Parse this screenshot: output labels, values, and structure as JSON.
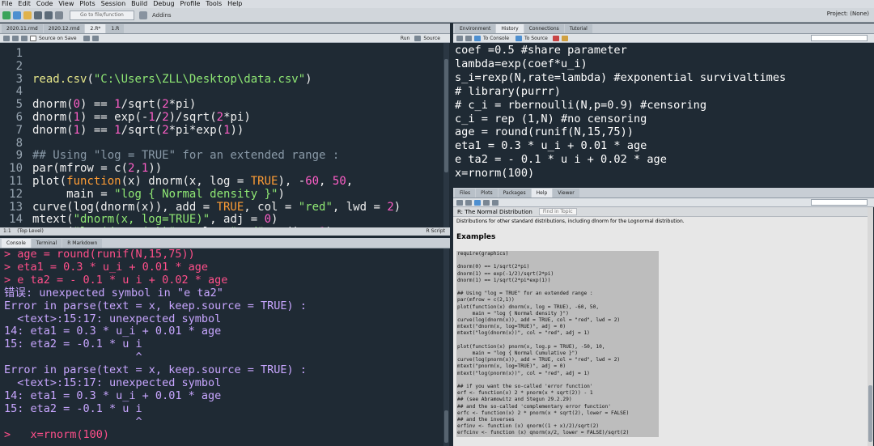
{
  "menu": [
    "File",
    "Edit",
    "Code",
    "View",
    "Plots",
    "Session",
    "Build",
    "Debug",
    "Profile",
    "Tools",
    "Help"
  ],
  "toolbar": {
    "goto_placeholder": "Go to file/function",
    "addins": "Addins",
    "project": "Project: (None)"
  },
  "editor": {
    "tabs": [
      "2020.11.rmd",
      "2020.12.rmd",
      "2.R*",
      "1.R"
    ],
    "active_tab": "2.R*",
    "source_on_save": "Source on Save",
    "run_label": "Run",
    "source_label": "Source",
    "line_numbers": [
      "1",
      "2",
      "3",
      "4",
      "5",
      "6",
      "7",
      "8",
      "9",
      "10",
      "11",
      "12",
      "13",
      "14"
    ],
    "status_pos": "1:1",
    "status_scope": "(Top Level)",
    "status_type": "R Script"
  },
  "console": {
    "tabs": [
      "Console",
      "Terminal",
      "R Markdown"
    ],
    "lines": [
      {
        "cls": "c-in",
        "text": "> age = round(runif(N,15,75))"
      },
      {
        "cls": "c-in",
        "text": "> eta1 = 0.3 * u_i + 0.01 * age"
      },
      {
        "cls": "c-in",
        "text": "> e ta2 = - 0.1 * u i + 0.02 * age"
      },
      {
        "cls": "c-err",
        "text": "错误: unexpected symbol in \"e ta2\""
      },
      {
        "cls": "c-err",
        "text": "Error in parse(text = x, keep.source = TRUE) :"
      },
      {
        "cls": "c-err",
        "text": "  <text>:15:17: unexpected symbol"
      },
      {
        "cls": "c-err",
        "text": "14: eta1 = 0.3 * u_i + 0.01 * age"
      },
      {
        "cls": "c-err",
        "text": "15: eta2 = -0.1 * u i"
      },
      {
        "cls": "c-err",
        "text": "                    ^"
      },
      {
        "cls": "c-err",
        "text": "Error in parse(text = x, keep.source = TRUE) :"
      },
      {
        "cls": "c-err",
        "text": "  <text>:15:17: unexpected symbol"
      },
      {
        "cls": "c-err",
        "text": "14: eta1 = 0.3 * u_i + 0.01 * age"
      },
      {
        "cls": "c-err",
        "text": "15: eta2 = -0.1 * u i"
      },
      {
        "cls": "c-err",
        "text": "                    ^"
      },
      {
        "cls": "c-in",
        "text": ">   x=rnorm(100)"
      }
    ]
  },
  "environment": {
    "tabs": [
      "Environment",
      "History",
      "Connections",
      "Tutorial"
    ],
    "to_console": "To Console",
    "to_source": "To Source",
    "lines": [
      "coef =0.5 #share parameter",
      "lambda=exp(coef*u_i)",
      "s_i=rexp(N,rate=lambda) #exponential survivaltimes",
      "# library(purrr)",
      "# c_i = rbernoulli(N,p=0.9) #censoring",
      "c_i = rep (1,N) #no censoring",
      "age = round(runif(N,15,75))",
      "eta1 = 0.3 * u_i + 0.01 * age",
      "e ta2 = - 0.1 * u i + 0.02 * age",
      "x=rnorm(100)"
    ]
  },
  "help": {
    "tabs": [
      "Files",
      "Plots",
      "Packages",
      "Help",
      "Viewer"
    ],
    "title": "R: The Normal Distribution",
    "find": "Find in Topic",
    "intro": "Distributions for other standard distributions, including dlnorm for the Lognormal distribution.",
    "examples_heading": "Examples",
    "code": "require(graphics)\n\ndnorm(0) == 1/sqrt(2*pi)\ndnorm(1) == exp(-1/2)/sqrt(2*pi)\ndnorm(1) == 1/sqrt(2*pi*exp(1))\n\n## Using \"log = TRUE\" for an extended range :\npar(mfrow = c(2,1))\nplot(function(x) dnorm(x, log = TRUE), -60, 50,\n     main = \"log { Normal density }\")\ncurve(log(dnorm(x)), add = TRUE, col = \"red\", lwd = 2)\nmtext(\"dnorm(x, log=TRUE)\", adj = 0)\nmtext(\"log(dnorm(x))\", col = \"red\", adj = 1)\n\nplot(function(x) pnorm(x, log.p = TRUE), -50, 10,\n     main = \"log { Normal Cumulative }\")\ncurve(log(pnorm(x)), add = TRUE, col = \"red\", lwd = 2)\nmtext(\"pnorm(x, log=TRUE)\", adj = 0)\nmtext(\"log(pnorm(x))\", col = \"red\", adj = 1)\n\n## if you want the so-called 'error function'\nerf <- function(x) 2 * pnorm(x * sqrt(2)) - 1\n## (see Abramowitz and Stegun 29.2.29)\n## and the so-called 'complementary error function'\nerfc <- function(x) 2 * pnorm(x * sqrt(2), lower = FALSE)\n## and the inverses\nerfinv <- function (x) qnorm((1 + x)/2)/sqrt(2)\nerfcinv <- function (x) qnorm(x/2, lower = FALSE)/sqrt(2)"
  }
}
